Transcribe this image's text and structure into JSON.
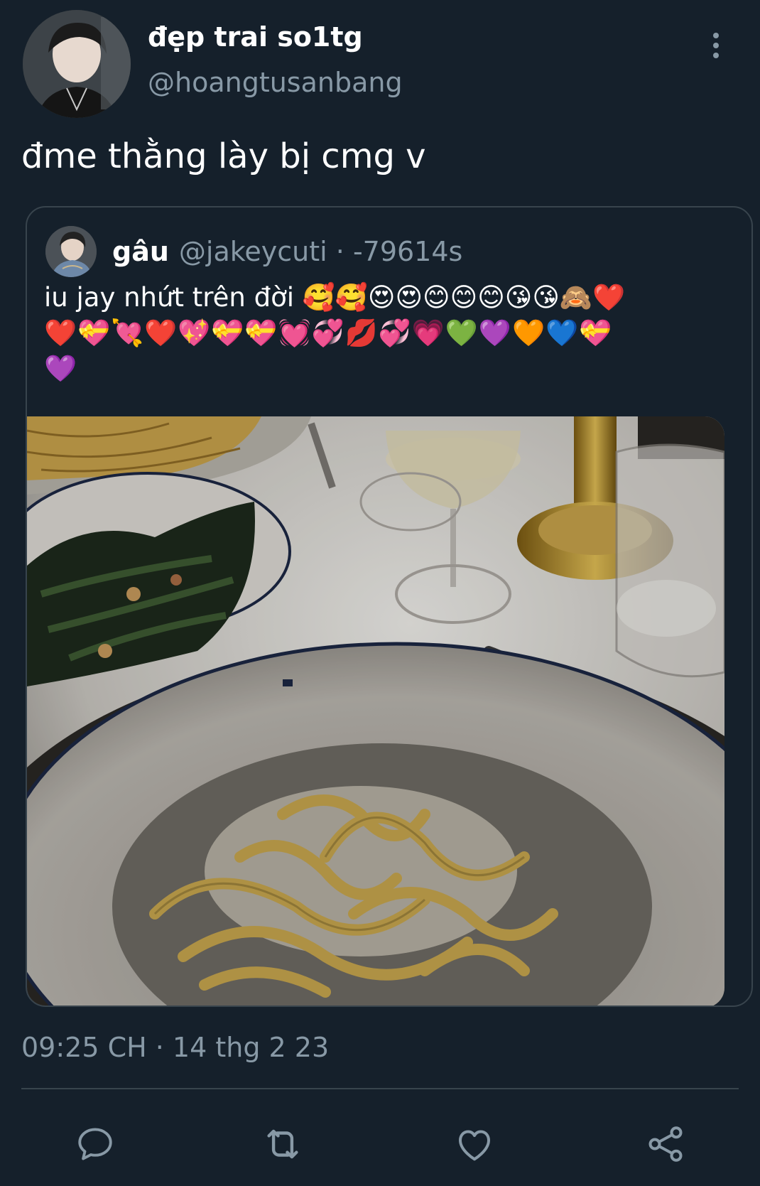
{
  "tweet": {
    "author": {
      "display_name": "đẹp trai so1tg",
      "handle": "@hoangtusanbang"
    },
    "text": "đme thằng lày bị cmg v",
    "timestamp": "09:25 CH · 14 thg 2 23"
  },
  "quoted_tweet": {
    "display_name": "gâu",
    "handle": "@jakeycuti · -79614s",
    "text_line1": "iu jay nhứt trên đời 🥰🥰😍😍😊😊😊😘😘🙈❤️",
    "text_line2": "❤️💝💘❤️💖💝💝💓💞💋💞💗💚💜🧡💙💝",
    "text_line3": "💜"
  },
  "icons": {
    "more": "more-vertical-icon",
    "reply": "reply-icon",
    "retweet": "retweet-icon",
    "like": "heart-icon",
    "share": "share-icon"
  },
  "colors": {
    "background": "#15202b",
    "secondary_text": "#8899a6",
    "border": "#38444d",
    "action_icon": "#8899a6"
  }
}
